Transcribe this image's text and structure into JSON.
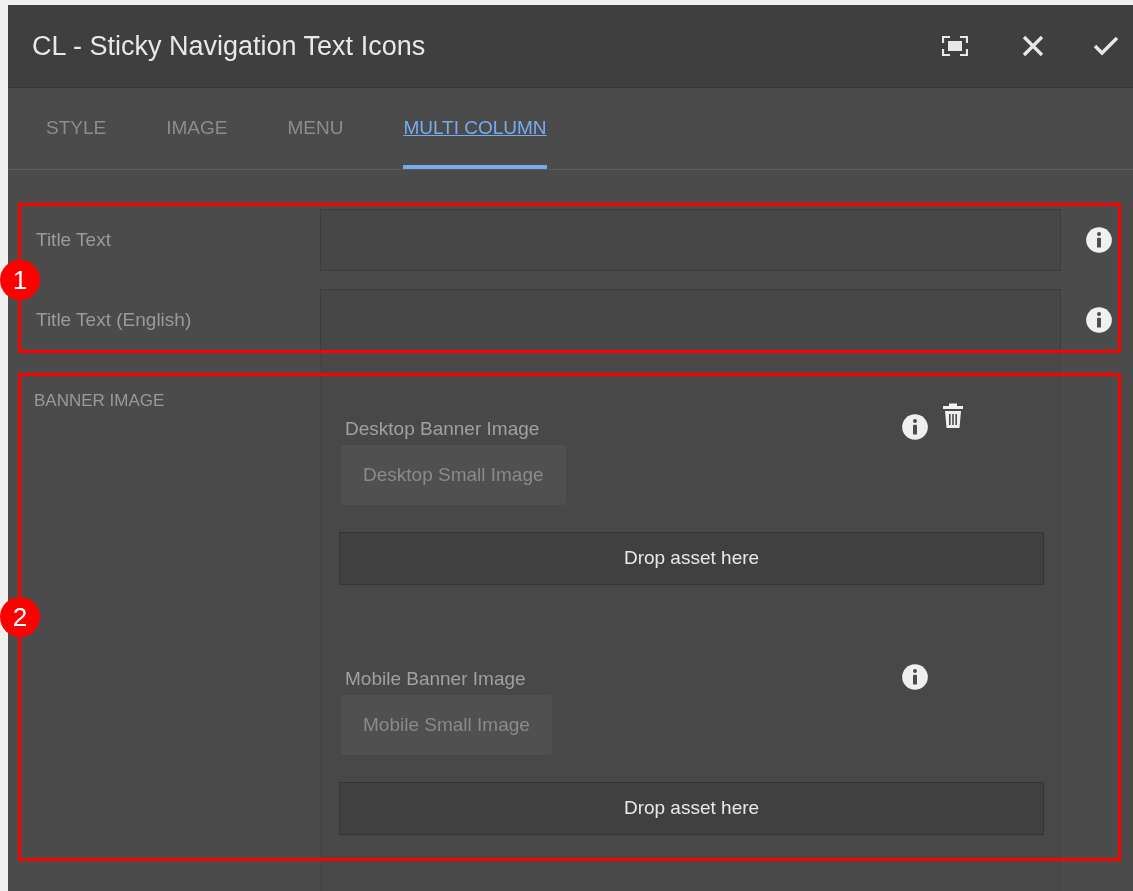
{
  "dialog": {
    "title": "CL - Sticky Navigation Text Icons"
  },
  "tabs": [
    {
      "label": "STYLE",
      "selected": false
    },
    {
      "label": "IMAGE",
      "selected": false
    },
    {
      "label": "MENU",
      "selected": false
    },
    {
      "label": "MULTI COLUMN",
      "selected": true
    }
  ],
  "fields": [
    {
      "label": "Title Text"
    },
    {
      "label": "Title Text (English)"
    }
  ],
  "banner_section": {
    "heading": "BANNER IMAGE",
    "groups": [
      {
        "label": "Desktop Banner Image",
        "button": {
          "label": "Desktop Small Image",
          "disabled": true
        },
        "drop_zone": "Drop asset here",
        "deletable": true
      },
      {
        "label": "Mobile Banner Image",
        "button": {
          "label": "Mobile Small Image",
          "disabled": true
        },
        "drop_zone": "Drop asset here",
        "deletable": false
      }
    ]
  },
  "annotations": [
    {
      "label": "1"
    },
    {
      "label": "2"
    }
  ]
}
